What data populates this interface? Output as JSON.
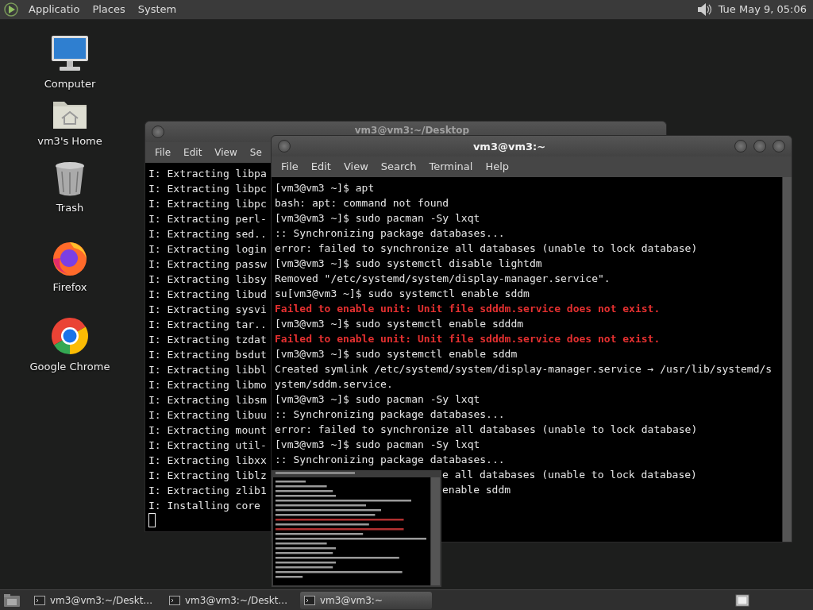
{
  "top_panel": {
    "menus": [
      "Applicatio",
      "Places",
      "System"
    ],
    "clock": "Tue May 9, 05:06"
  },
  "desktop_icons": [
    {
      "kind": "computer",
      "label": "Computer"
    },
    {
      "kind": "home",
      "label": "vm3's Home"
    },
    {
      "kind": "trash",
      "label": "Trash"
    },
    {
      "kind": "firefox",
      "label": "Firefox"
    },
    {
      "kind": "chrome",
      "label": "Google Chrome"
    }
  ],
  "windows": [
    {
      "title": "vm3@vm3:~/Desktop",
      "active": false,
      "menus": [
        "File",
        "Edit",
        "View",
        "Se"
      ],
      "cursor": true,
      "lines": [
        {
          "kind": "output",
          "text": "I: Extracting libpa"
        },
        {
          "kind": "output",
          "text": "I: Extracting libpc"
        },
        {
          "kind": "output",
          "text": "I: Extracting libpc"
        },
        {
          "kind": "output",
          "text": "I: Extracting perl-"
        },
        {
          "kind": "output",
          "text": "I: Extracting sed.."
        },
        {
          "kind": "output",
          "text": "I: Extracting login"
        },
        {
          "kind": "output",
          "text": "I: Extracting passw"
        },
        {
          "kind": "output",
          "text": "I: Extracting libsy"
        },
        {
          "kind": "output",
          "text": "I: Extracting libud"
        },
        {
          "kind": "output",
          "text": "I: Extracting sysvi"
        },
        {
          "kind": "output",
          "text": "I: Extracting tar.."
        },
        {
          "kind": "output",
          "text": "I: Extracting tzdat"
        },
        {
          "kind": "output",
          "text": "I: Extracting bsdut"
        },
        {
          "kind": "output",
          "text": "I: Extracting libbl"
        },
        {
          "kind": "output",
          "text": "I: Extracting libmo"
        },
        {
          "kind": "output",
          "text": "I: Extracting libsm"
        },
        {
          "kind": "output",
          "text": "I: Extracting libuu"
        },
        {
          "kind": "output",
          "text": "I: Extracting mount"
        },
        {
          "kind": "output",
          "text": "I: Extracting util-"
        },
        {
          "kind": "output",
          "text": "I: Extracting libxx"
        },
        {
          "kind": "output",
          "text": "I: Extracting liblz"
        },
        {
          "kind": "output",
          "text": "I: Extracting zlib1"
        },
        {
          "kind": "output",
          "text": "I: Installing core"
        }
      ]
    },
    {
      "title": "vm3@vm3:~",
      "active": true,
      "menus": [
        "File",
        "Edit",
        "View",
        "Search",
        "Terminal",
        "Help"
      ],
      "cursor": false,
      "lines": [
        {
          "kind": "output",
          "text": "[vm3@vm3 ~]$ apt"
        },
        {
          "kind": "output",
          "text": "bash: apt: command not found"
        },
        {
          "kind": "output",
          "text": "[vm3@vm3 ~]$ sudo pacman -Sy lxqt"
        },
        {
          "kind": "output",
          "text": ":: Synchronizing package databases..."
        },
        {
          "kind": "output",
          "text": "error: failed to synchronize all databases (unable to lock database)"
        },
        {
          "kind": "output",
          "text": "[vm3@vm3 ~]$ sudo systemctl disable lightdm"
        },
        {
          "kind": "output",
          "text": "Removed \"/etc/systemd/system/display-manager.service\"."
        },
        {
          "kind": "output",
          "text": "su[vm3@vm3 ~]$ sudo systemctl enable sddm"
        },
        {
          "kind": "error",
          "text": "Failed to enable unit: Unit file sdddm.service does not exist."
        },
        {
          "kind": "output",
          "text": "[vm3@vm3 ~]$ sudo systemctl enable sdddm"
        },
        {
          "kind": "error",
          "text": "Failed to enable unit: Unit file sdddm.service does not exist."
        },
        {
          "kind": "output",
          "text": "[vm3@vm3 ~]$ sudo systemctl enable sddm"
        },
        {
          "kind": "output",
          "text": "Created symlink /etc/systemd/system/display-manager.service → /usr/lib/systemd/s"
        },
        {
          "kind": "output",
          "text": "ystem/sddm.service."
        },
        {
          "kind": "output",
          "text": "[vm3@vm3 ~]$ sudo pacman -Sy lxqt"
        },
        {
          "kind": "output",
          "text": ":: Synchronizing package databases..."
        },
        {
          "kind": "output",
          "text": "error: failed to synchronize all databases (unable to lock database)"
        },
        {
          "kind": "output",
          "text": "[vm3@vm3 ~]$ sudo pacman -Sy lxqt"
        },
        {
          "kind": "output",
          "text": ":: Synchronizing package databases..."
        },
        {
          "kind": "covered",
          "text": "e all databases (unable to lock database)"
        },
        {
          "kind": "covered",
          "text": "enable sddm"
        }
      ]
    }
  ],
  "taskbar": {
    "tasks": [
      {
        "label": "vm3@vm3:~/Deskt...",
        "selected": false
      },
      {
        "label": "vm3@vm3:~/Deskt...",
        "selected": false
      },
      {
        "label": "vm3@vm3:~",
        "selected": true
      }
    ]
  }
}
